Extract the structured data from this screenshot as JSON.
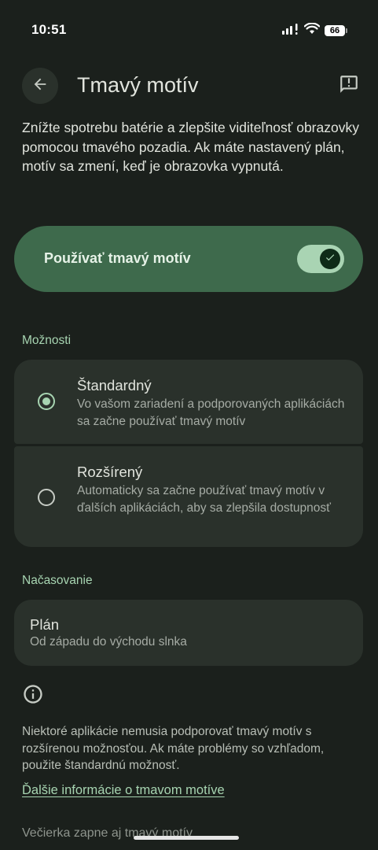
{
  "status_bar": {
    "time": "10:51",
    "battery": "66",
    "icons": [
      "signal-icon",
      "wifi-icon",
      "battery-icon"
    ]
  },
  "header": {
    "title": "Tmavý motív",
    "back_icon": "arrow-back-icon",
    "feedback_icon": "feedback-icon"
  },
  "description": "Znížte spotrebu batérie a zlepšite viditeľnosť obrazovky pomocou tmavého pozadia. Ak máte nastavený plán, motív sa zmení, keď je obrazovka vypnutá.",
  "main_toggle": {
    "label": "Používať tmavý motív",
    "enabled": true
  },
  "options": {
    "section_label": "Možnosti",
    "items": [
      {
        "title": "Štandardný",
        "description": "Vo vašom zariadení a podporovaných aplikáciách sa začne používať tmavý motív",
        "selected": true
      },
      {
        "title": "Rozšírený",
        "description": "Automaticky sa začne používať tmavý motív v ďalších aplikáciách, aby sa zlepšila dostupnosť",
        "selected": false
      }
    ]
  },
  "schedule": {
    "section_label": "Načasovanie",
    "title": "Plán",
    "value": "Od západu do východu slnka"
  },
  "info": {
    "icon": "info-icon",
    "text": "Niektoré aplikácie nemusia podporovať tmavý motív s rozšírenou možnosťou. Ak máte problémy so vzhľadom, použite štandardnú možnosť.",
    "link": "Ďalšie informácie o tmavom motíve"
  },
  "footer_text": "Večierka zapne aj tmavý motív",
  "colors": {
    "background": "#1b201c",
    "card": "#2a312b",
    "toggle_card": "#3e6a4c",
    "accent": "#a7d4b1",
    "text_primary": "#e1e4dd",
    "text_secondary": "#a6aca5"
  }
}
